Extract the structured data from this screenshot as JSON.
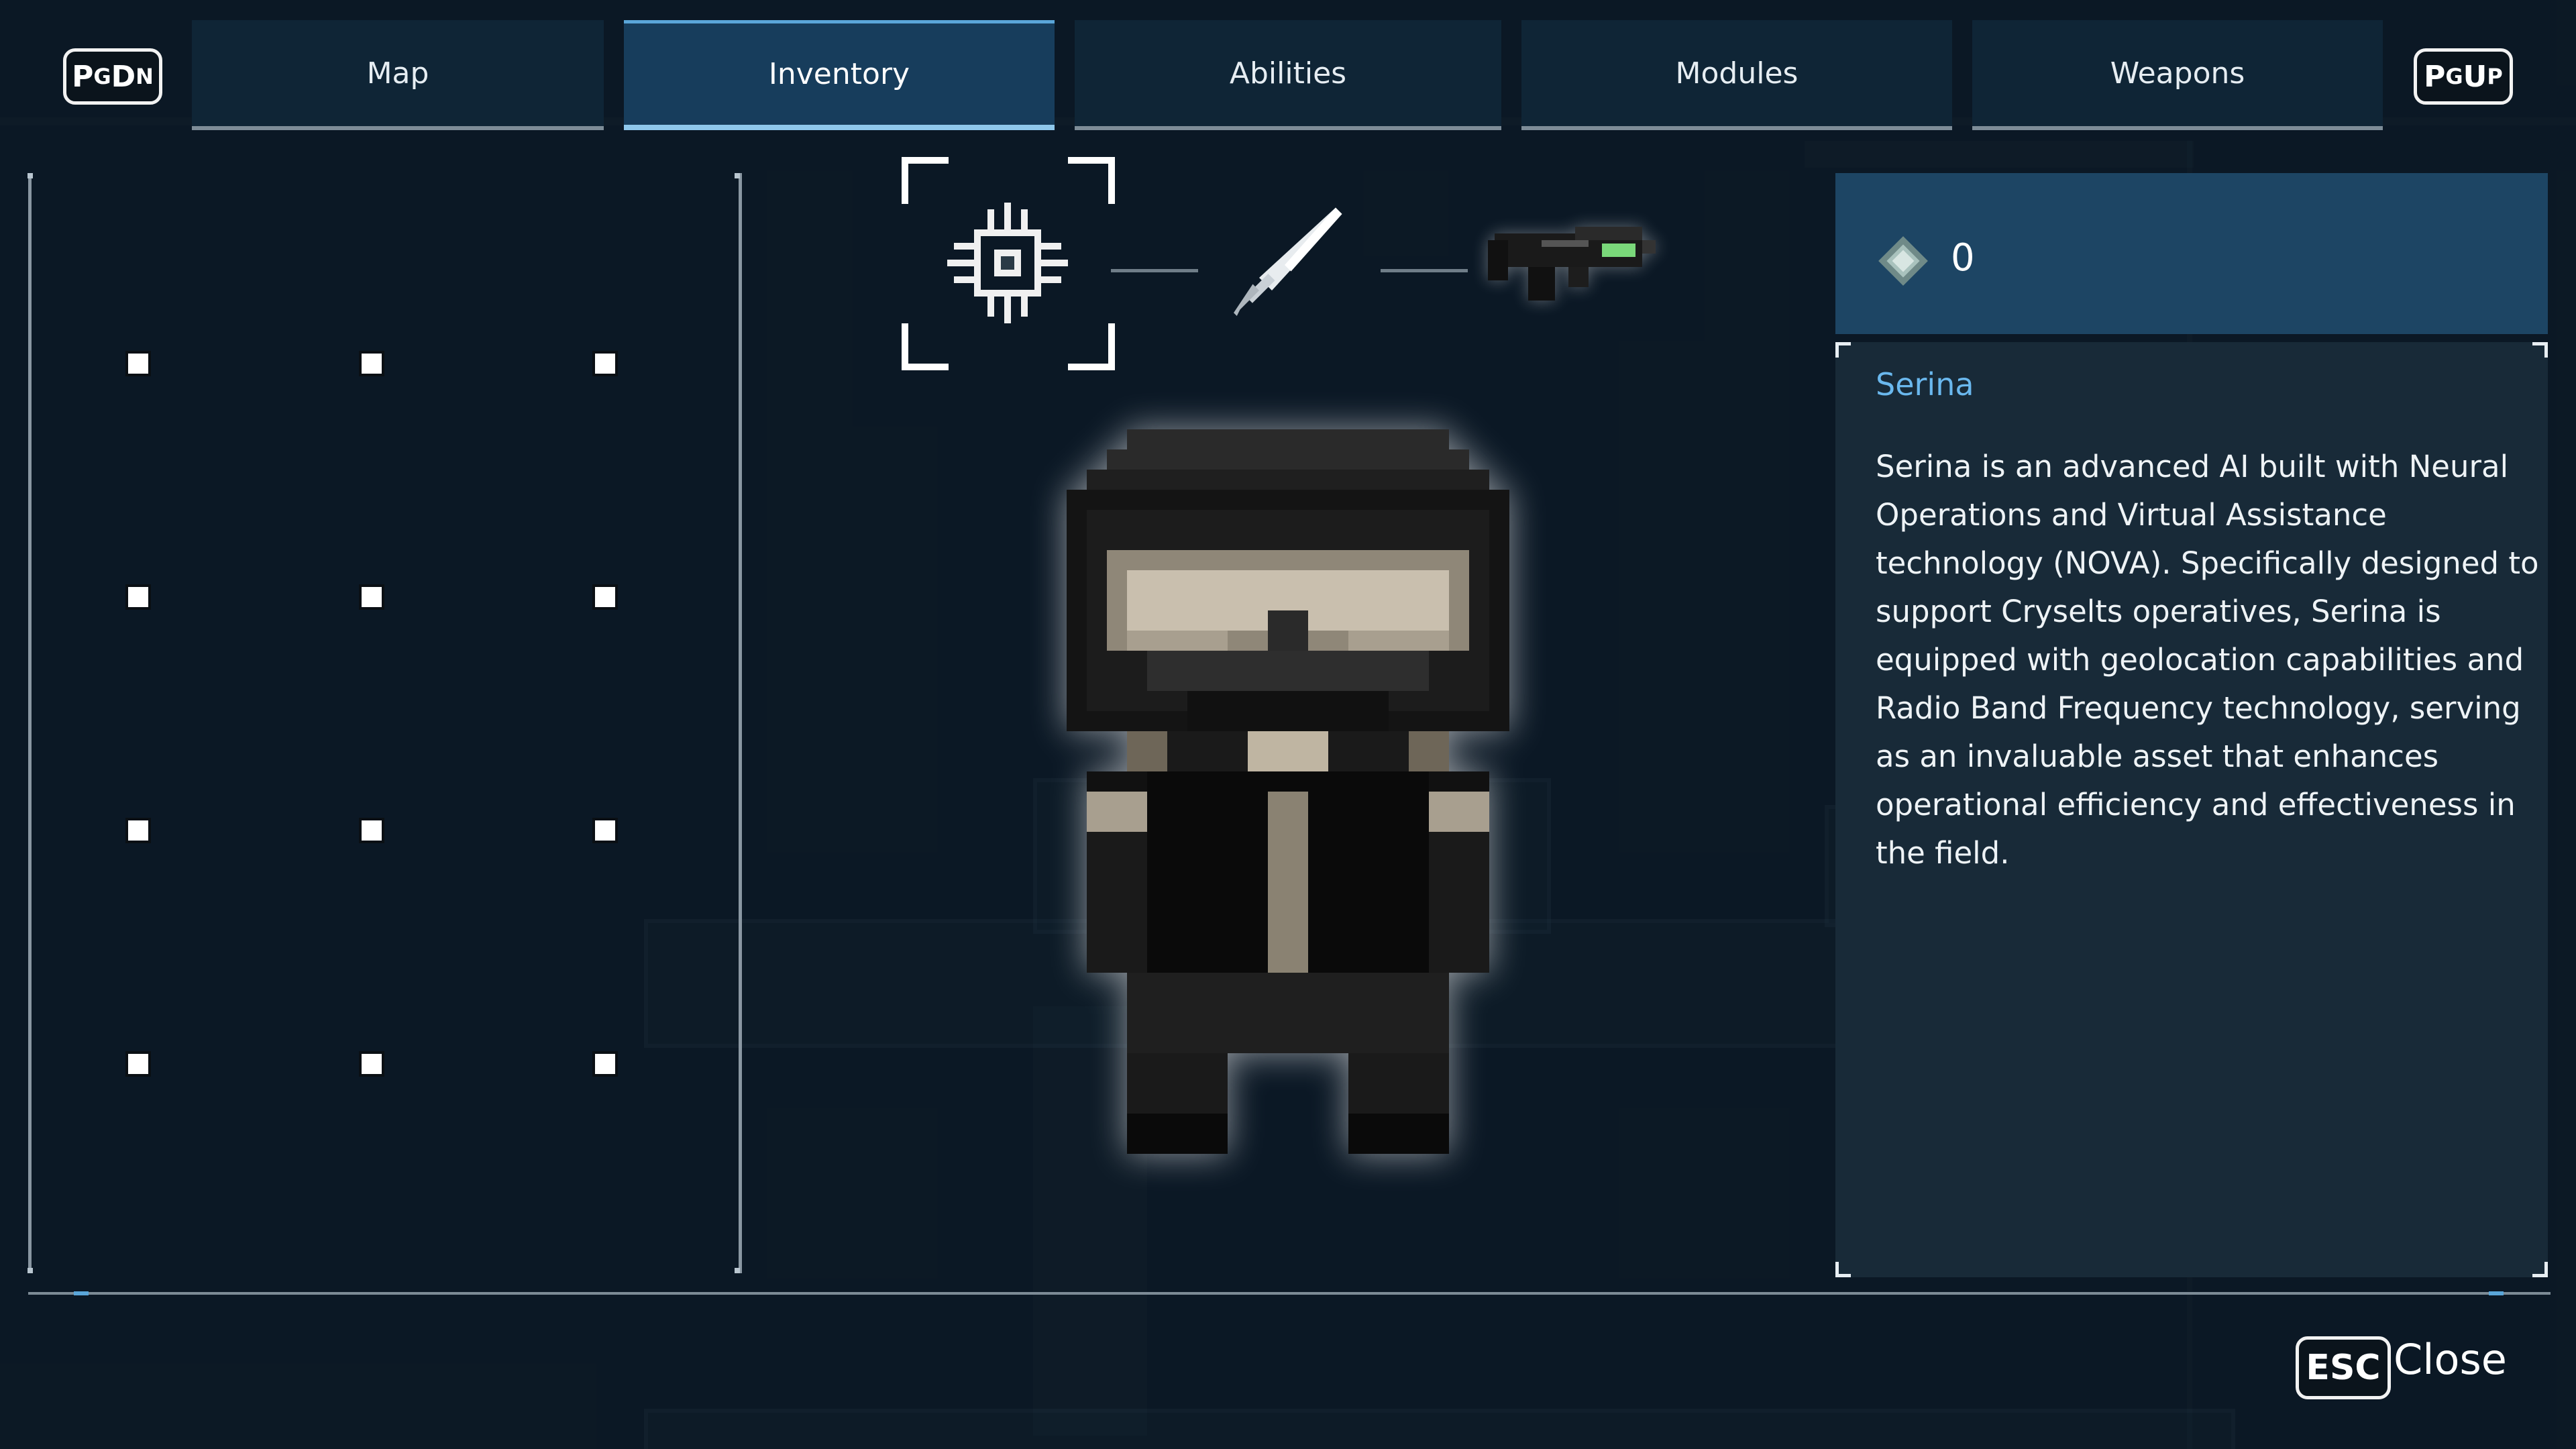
{
  "nav": {
    "prev_key": {
      "big": "P",
      "small_a": "G",
      "big_b": "D",
      "small_b": "N"
    },
    "next_key": {
      "big": "P",
      "small_a": "G",
      "big_b": "U",
      "small_b": "P"
    },
    "tabs": [
      {
        "label": "Map",
        "active": false
      },
      {
        "label": "Inventory",
        "active": true
      },
      {
        "label": "Abilities",
        "active": false
      },
      {
        "label": "Modules",
        "active": false
      },
      {
        "label": "Weapons",
        "active": false
      }
    ]
  },
  "inventory": {
    "rows": 4,
    "cols": 3,
    "slot_count": 12
  },
  "equipment": [
    {
      "name": "ai-chip-icon",
      "selected": true
    },
    {
      "name": "sword-icon",
      "selected": false
    },
    {
      "name": "rifle-icon",
      "selected": false
    }
  ],
  "info": {
    "gem_icon": "gem-icon",
    "gem_count": "0",
    "name": "Serina",
    "description": "Serina is an advanced AI built with Neural Operations and Virtual Assistance technology (NOVA). Specifically designed to support Cryselts operatives, Serina is equipped with geolocation capabilities and Radio Band Frequency technology, serving as an invaluable asset that enhances operational efficiency and effectiveness in the field."
  },
  "footer": {
    "esc_key": "ESC",
    "close_label": "Close"
  },
  "colors": {
    "background": "#0f1c28",
    "tab": "#0f2536",
    "tab_active": "#173d5c",
    "accent": "#5aa6d9",
    "name_text": "#6ab8ee",
    "info_header": "#1d4564"
  }
}
